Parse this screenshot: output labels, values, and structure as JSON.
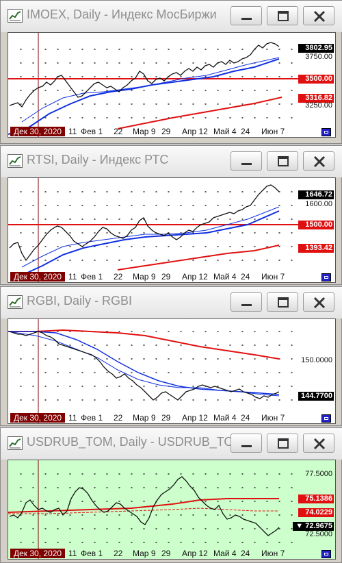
{
  "windows": [
    {
      "title": "IMOEX, Daily - Индекс МосБиржи",
      "cursor_date": "Дек 30, 2020",
      "background": "#ffffff",
      "x_ticks": [
        "11",
        "Фев 1",
        "22",
        "Мар 9",
        "29",
        "Апр 12",
        "Май 4",
        "24",
        "Июн 7"
      ],
      "price_labels": [
        {
          "text": "3802.95",
          "style": "black"
        },
        {
          "text": "3750.00",
          "style": "tick"
        },
        {
          "text": "3500.00",
          "style": "red"
        },
        {
          "text": "3316.82",
          "style": "red"
        },
        {
          "text": "3250.00",
          "style": "tick"
        }
      ]
    },
    {
      "title": "RTSI, Daily - Индекс РТС",
      "cursor_date": "Дек 30, 2020",
      "background": "#ffffff",
      "x_ticks": [
        "11",
        "Фев 1",
        "22",
        "Мар 9",
        "29",
        "Апр 12",
        "Май 4",
        "24",
        "Июн 7"
      ],
      "price_labels": [
        {
          "text": "1646.72",
          "style": "black"
        },
        {
          "text": "1600.00",
          "style": "tick"
        },
        {
          "text": "1500.00",
          "style": "red"
        },
        {
          "text": "1393.42",
          "style": "red"
        }
      ]
    },
    {
      "title": "RGBI, Daily - RGBI",
      "cursor_date": "Дек 30, 2020",
      "background": "#ffffff",
      "x_ticks": [
        "11",
        "Фев 1",
        "22",
        "Мар 9",
        "29",
        "Апр 12",
        "Май 4",
        "24",
        "Июн 7"
      ],
      "price_labels": [
        {
          "text": "150.0000",
          "style": "tick"
        },
        {
          "text": "144.7700",
          "style": "black"
        }
      ]
    },
    {
      "title": "USDRUB_TOM, Daily - USDRUB_TOM",
      "cursor_date": "Дек 30, 2020",
      "background": "#ccffcc",
      "x_ticks": [
        "11",
        "Фев 1",
        "22",
        "Мар 9",
        "29",
        "Апр 12",
        "Май 4",
        "24",
        "Июн 7"
      ],
      "price_labels": [
        {
          "text": "77.5000",
          "style": "tick"
        },
        {
          "text": "75.1386",
          "style": "red"
        },
        {
          "text": "74.0229",
          "style": "red"
        },
        {
          "text": "▼ 72.9675",
          "style": "black"
        },
        {
          "text": "72.5000",
          "style": "tick"
        }
      ]
    }
  ]
}
